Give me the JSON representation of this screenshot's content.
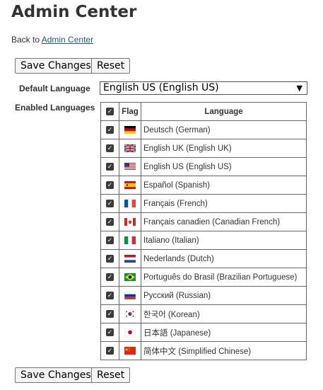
{
  "page": {
    "title": "Admin Center"
  },
  "nav": {
    "back_prefix": "Back to",
    "back_link": "Admin Center"
  },
  "buttons": {
    "save": "Save Changes",
    "reset": "Reset"
  },
  "default_language": {
    "label": "Default Language",
    "selected": "English US (English US)"
  },
  "enabled_languages": {
    "label": "Enabled Languages",
    "columns": {
      "flag": "Flag",
      "language": "Language"
    },
    "items": [
      {
        "name": "Deutsch (German)",
        "flag": "de-flag-icon",
        "checked": true
      },
      {
        "name": "English UK (English UK)",
        "flag": "uk-flag-icon",
        "checked": true
      },
      {
        "name": "English US (English US)",
        "flag": "us-flag-icon",
        "checked": true
      },
      {
        "name": "Español (Spanish)",
        "flag": "es-flag-icon",
        "checked": true
      },
      {
        "name": "Français (French)",
        "flag": "fr-flag-icon",
        "checked": true
      },
      {
        "name": "Français canadien (Canadian French)",
        "flag": "ca-flag-icon",
        "checked": true
      },
      {
        "name": "Italiano (Italian)",
        "flag": "it-flag-icon",
        "checked": true
      },
      {
        "name": "Nederlands (Dutch)",
        "flag": "nl-flag-icon",
        "checked": true
      },
      {
        "name": "Português do Brasil (Brazilian Portuguese)",
        "flag": "br-flag-icon",
        "checked": true
      },
      {
        "name": "Русский (Russian)",
        "flag": "ru-flag-icon",
        "checked": true
      },
      {
        "name": "한국어 (Korean)",
        "flag": "kr-flag-icon",
        "checked": true
      },
      {
        "name": "日本語 (Japanese)",
        "flag": "jp-flag-icon",
        "checked": true
      },
      {
        "name": "简体中文 (Simplified Chinese)",
        "flag": "cn-flag-icon",
        "checked": true
      }
    ]
  }
}
